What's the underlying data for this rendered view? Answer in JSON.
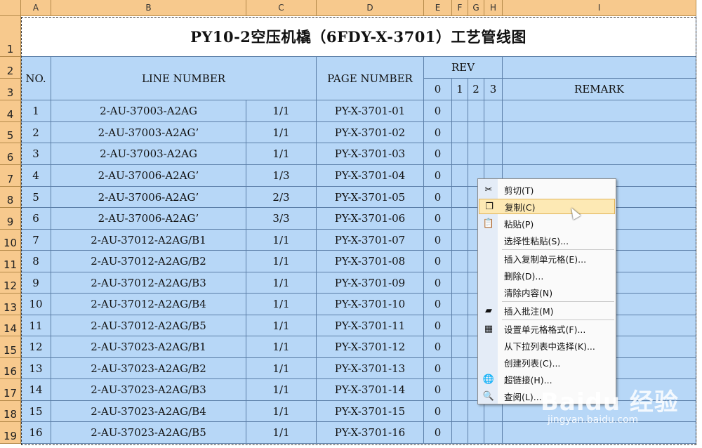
{
  "columns": [
    "A",
    "B",
    "C",
    "D",
    "E",
    "F",
    "G",
    "H",
    "I"
  ],
  "rows": [
    "1",
    "2",
    "3",
    "4",
    "5",
    "6",
    "7",
    "8",
    "9",
    "10",
    "11",
    "12",
    "13",
    "14",
    "15",
    "16",
    "17",
    "18",
    "19"
  ],
  "title": "PY10-2空压机橇（6FDY-X-3701）工艺管线图",
  "headers": {
    "no": "NO.",
    "line_number": "LINE NUMBER",
    "page_number": "PAGE NUMBER",
    "rev": "REV",
    "rev_cols": [
      "0",
      "1",
      "2",
      "3"
    ],
    "remark": "REMARK"
  },
  "table": [
    {
      "no": "1",
      "line": "2-AU-37003-A2AG",
      "sheet": "1/1",
      "page": "PY-X-3701-01",
      "rev": "0"
    },
    {
      "no": "2",
      "line": "2-AU-37003-A2AG’",
      "sheet": "1/1",
      "page": "PY-X-3701-02",
      "rev": "0"
    },
    {
      "no": "3",
      "line": "2-AU-37003-A2AG",
      "sheet": "1/1",
      "page": "PY-X-3701-03",
      "rev": "0"
    },
    {
      "no": "4",
      "line": "2-AU-37006-A2AG’",
      "sheet": "1/3",
      "page": "PY-X-3701-04",
      "rev": "0"
    },
    {
      "no": "5",
      "line": "2-AU-37006-A2AG’",
      "sheet": "2/3",
      "page": "PY-X-3701-05",
      "rev": "0"
    },
    {
      "no": "6",
      "line": "2-AU-37006-A2AG’",
      "sheet": "3/3",
      "page": "PY-X-3701-06",
      "rev": "0"
    },
    {
      "no": "7",
      "line": "2-AU-37012-A2AG/B1",
      "sheet": "1/1",
      "page": "PY-X-3701-07",
      "rev": "0"
    },
    {
      "no": "8",
      "line": "2-AU-37012-A2AG/B2",
      "sheet": "1/1",
      "page": "PY-X-3701-08",
      "rev": "0"
    },
    {
      "no": "9",
      "line": "2-AU-37012-A2AG/B3",
      "sheet": "1/1",
      "page": "PY-X-3701-09",
      "rev": "0"
    },
    {
      "no": "10",
      "line": "2-AU-37012-A2AG/B4",
      "sheet": "1/1",
      "page": "PY-X-3701-10",
      "rev": "0"
    },
    {
      "no": "11",
      "line": "2-AU-37012-A2AG/B5",
      "sheet": "1/1",
      "page": "PY-X-3701-11",
      "rev": "0"
    },
    {
      "no": "12",
      "line": "2-AU-37023-A2AG/B1",
      "sheet": "1/1",
      "page": "PY-X-3701-12",
      "rev": "0"
    },
    {
      "no": "13",
      "line": "2-AU-37023-A2AG/B2",
      "sheet": "1/1",
      "page": "PY-X-3701-13",
      "rev": "0"
    },
    {
      "no": "14",
      "line": "2-AU-37023-A2AG/B3",
      "sheet": "1/1",
      "page": "PY-X-3701-14",
      "rev": "0"
    },
    {
      "no": "15",
      "line": "2-AU-37023-A2AG/B4",
      "sheet": "1/1",
      "page": "PY-X-3701-15",
      "rev": "0"
    },
    {
      "no": "16",
      "line": "2-AU-37023-A2AG/B5",
      "sheet": "1/1",
      "page": "PY-X-3701-16",
      "rev": "0"
    }
  ],
  "context_menu": {
    "items": [
      {
        "label": "剪切(T)",
        "icon": "scissors-icon",
        "glyph": "✂"
      },
      {
        "label": "复制(C)",
        "icon": "copy-icon",
        "glyph": "❐",
        "highlighted": true
      },
      {
        "label": "粘贴(P)",
        "icon": "paste-icon",
        "glyph": "📋"
      },
      {
        "label": "选择性粘贴(S)...",
        "icon": "",
        "glyph": ""
      },
      {
        "label": "插入复制单元格(E)...",
        "icon": "",
        "glyph": ""
      },
      {
        "label": "删除(D)...",
        "icon": "",
        "glyph": ""
      },
      {
        "label": "清除内容(N)",
        "icon": "",
        "glyph": ""
      },
      {
        "label": "插入批注(M)",
        "icon": "comment-folder-icon",
        "glyph": "▰"
      },
      {
        "label": "设置单元格格式(F)...",
        "icon": "format-cells-icon",
        "glyph": "▦"
      },
      {
        "label": "从下拉列表中选择(K)...",
        "icon": "",
        "glyph": ""
      },
      {
        "label": "创建列表(C)...",
        "icon": "",
        "glyph": ""
      },
      {
        "label": "超链接(H)...",
        "icon": "hyperlink-icon",
        "glyph": "🌐"
      },
      {
        "label": "查阅(L)...",
        "icon": "research-icon",
        "glyph": "🔍"
      }
    ]
  },
  "watermark": {
    "brand": "Baidu 经验",
    "url": "jingyan.baidu.com"
  },
  "colors": {
    "header": "#f7c98d",
    "cell": "#b7d7f7",
    "grid": "#5c7fa8",
    "highlight": "#fde9b4"
  }
}
